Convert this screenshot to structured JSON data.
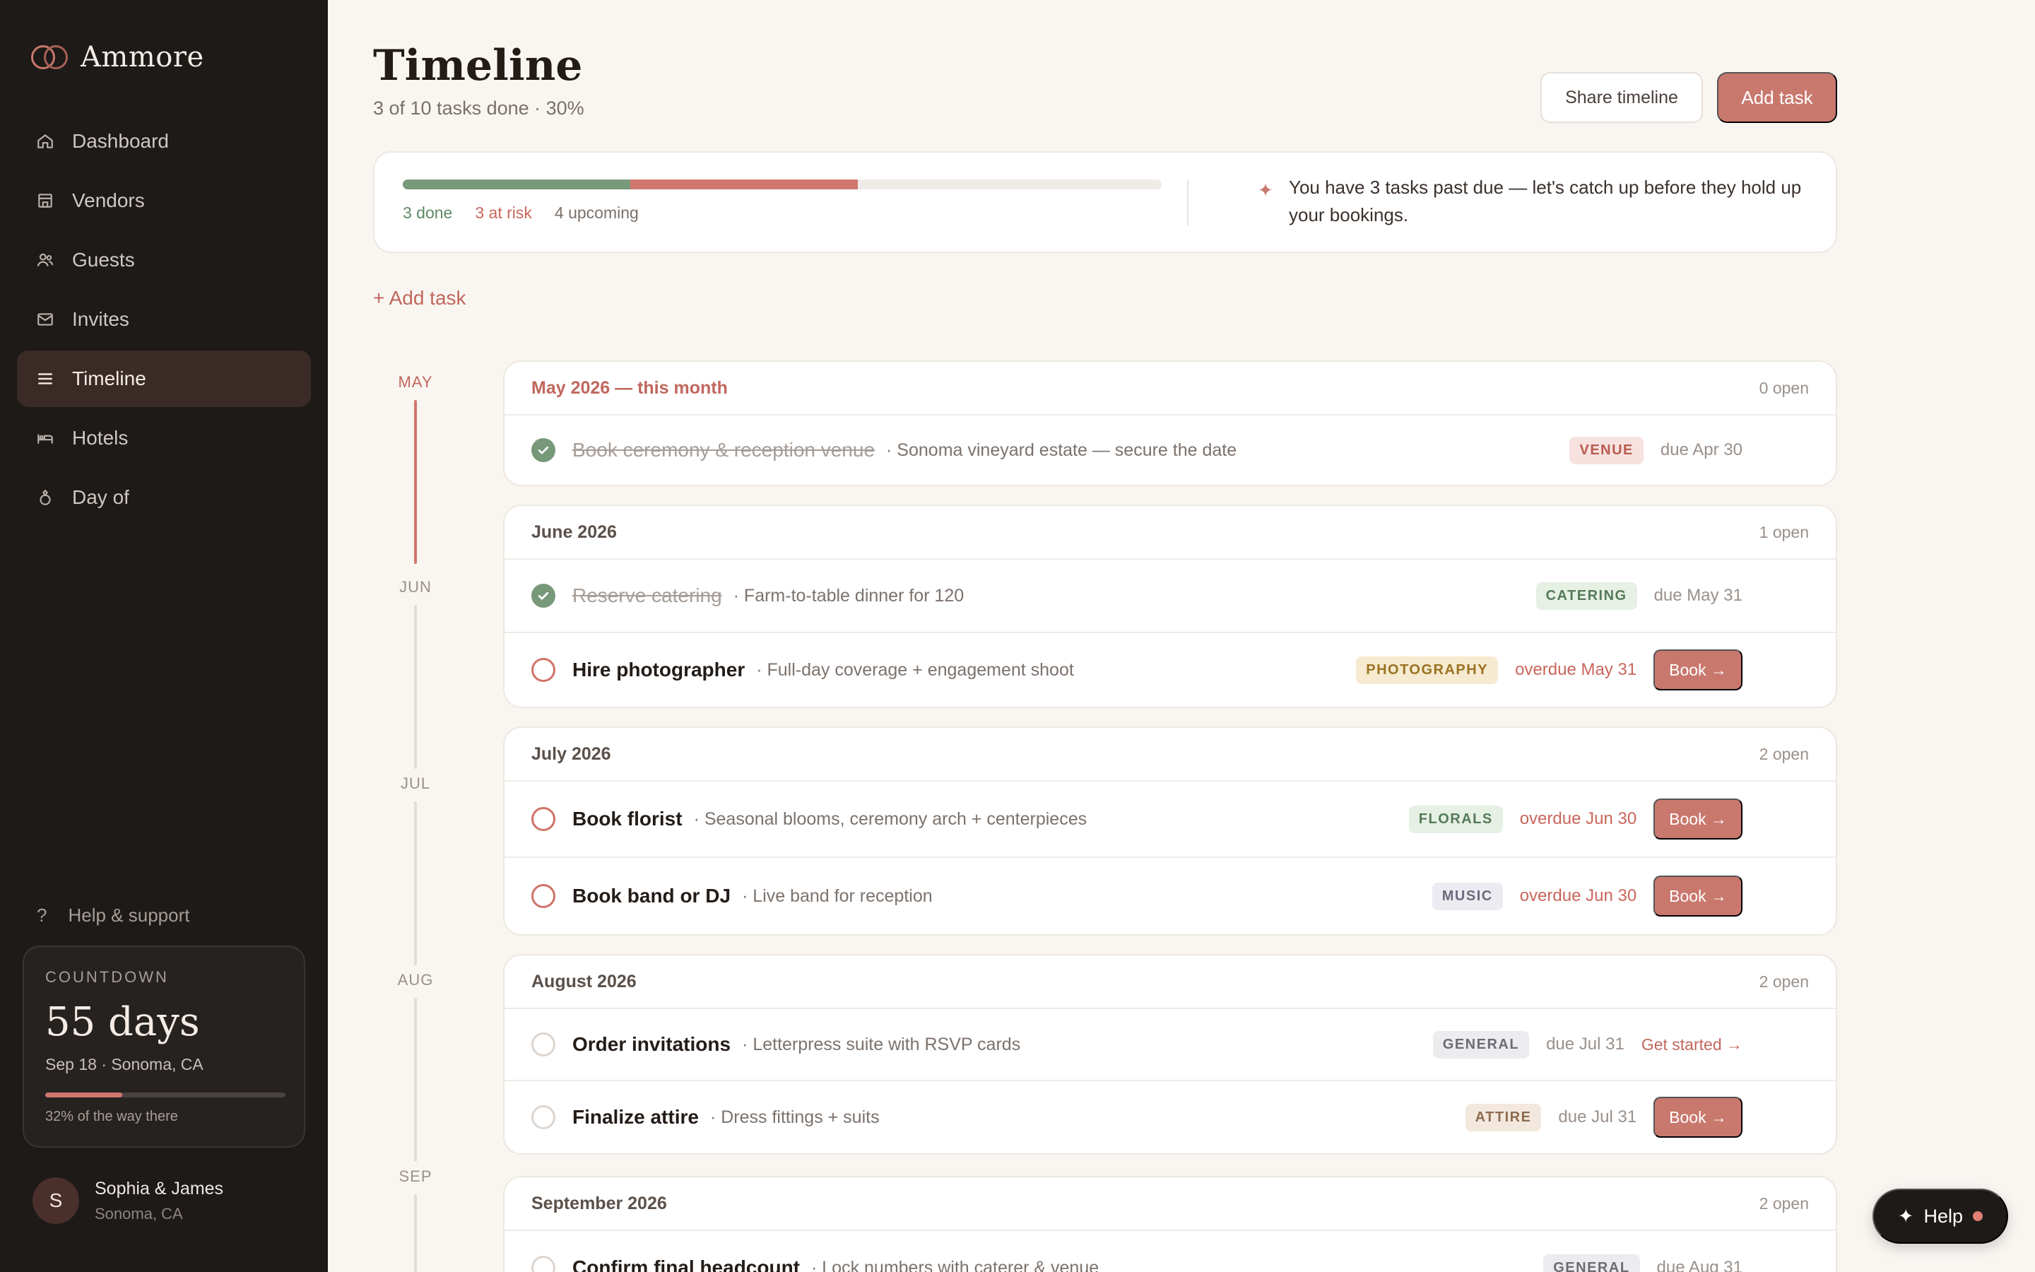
{
  "brand": {
    "name": "Ammore"
  },
  "nav": [
    {
      "label": "Dashboard",
      "icon": "home-icon"
    },
    {
      "label": "Vendors",
      "icon": "store-icon"
    },
    {
      "label": "Guests",
      "icon": "users-icon"
    },
    {
      "label": "Invites",
      "icon": "mail-icon"
    },
    {
      "label": "Timeline",
      "icon": "list-icon",
      "active": true
    },
    {
      "label": "Hotels",
      "icon": "bed-icon"
    },
    {
      "label": "Day of",
      "icon": "ring-icon"
    }
  ],
  "help_link": {
    "icon": "?",
    "label": "Help & support"
  },
  "countdown": {
    "label": "COUNTDOWN",
    "days": "55 days",
    "sub": "Sep 18 · Sonoma, CA",
    "progress": 0.32,
    "note": "32% of the way there"
  },
  "user": {
    "initial": "S",
    "name": "Sophia & James",
    "location": "Sonoma, CA"
  },
  "header": {
    "title": "Timeline",
    "subtitle": "3 of 10 tasks done · 30%",
    "share_label": "Share timeline",
    "add_label": "Add task"
  },
  "progress": {
    "done_fraction": 0.3,
    "risk_fraction": 0.3,
    "done_label": "3 done",
    "risk_label": "3 at risk",
    "upcoming_label": "4 upcoming",
    "alert_icon": "✦",
    "alert_text": "You have 3 tasks past due — let's catch up before they hold up your bookings."
  },
  "add_task_link": "+ Add task",
  "rail_months": [
    "MAY",
    "JUN",
    "JUL",
    "AUG",
    "SEP"
  ],
  "groups": [
    {
      "title": "May 2026 — this month",
      "current": true,
      "open": "0 open",
      "tasks": [
        {
          "name": "Book ceremony & reception venue",
          "desc": "· Sonoma vineyard estate — secure the date",
          "status": "done",
          "tag": "VENUE",
          "tag_class": "tag-venue",
          "due": "due Apr 30",
          "overdue": false,
          "action": ""
        }
      ]
    },
    {
      "title": "June 2026",
      "current": false,
      "open": "1 open",
      "tasks": [
        {
          "name": "Reserve catering",
          "desc": "· Farm-to-table dinner for 120",
          "status": "done",
          "tag": "CATERING",
          "tag_class": "tag-catering",
          "due": "due May 31",
          "overdue": false,
          "action": ""
        },
        {
          "name": "Hire photographer",
          "desc": "· Full-day coverage + engagement shoot",
          "status": "risk",
          "tag": "PHOTOGRAPHY",
          "tag_class": "tag-photo",
          "due": "overdue May 31",
          "overdue": true,
          "action": "Book →"
        }
      ]
    },
    {
      "title": "July 2026",
      "current": false,
      "open": "2 open",
      "tasks": [
        {
          "name": "Book florist",
          "desc": "· Seasonal blooms, ceremony arch + centerpieces",
          "status": "risk",
          "tag": "FLORALS",
          "tag_class": "tag-florals",
          "due": "overdue Jun 30",
          "overdue": true,
          "action": "Book →"
        },
        {
          "name": "Book band or DJ",
          "desc": "· Live band for reception",
          "status": "risk",
          "tag": "MUSIC",
          "tag_class": "tag-music",
          "due": "overdue Jun 30",
          "overdue": true,
          "action": "Book →"
        }
      ]
    },
    {
      "title": "August 2026",
      "current": false,
      "open": "2 open",
      "tasks": [
        {
          "name": "Order invitations",
          "desc": "· Letterpress suite with RSVP cards",
          "status": "open",
          "tag": "GENERAL",
          "tag_class": "tag-general",
          "due": "due Jul 31",
          "overdue": false,
          "action": "",
          "link": "Get started →"
        },
        {
          "name": "Finalize attire",
          "desc": "· Dress fittings + suits",
          "status": "open",
          "tag": "ATTIRE",
          "tag_class": "tag-attire",
          "due": "due Jul 31",
          "overdue": false,
          "action": "Book →"
        }
      ]
    },
    {
      "title": "September 2026",
      "current": false,
      "open": "2 open",
      "tasks": [
        {
          "name": "Confirm final headcount",
          "desc": "· Lock numbers with caterer & venue",
          "status": "open",
          "tag": "GENERAL",
          "tag_class": "tag-general",
          "due": "due Aug 31",
          "overdue": false,
          "action": ""
        }
      ]
    }
  ],
  "help_fab": {
    "icon": "✦",
    "label": "Help"
  }
}
